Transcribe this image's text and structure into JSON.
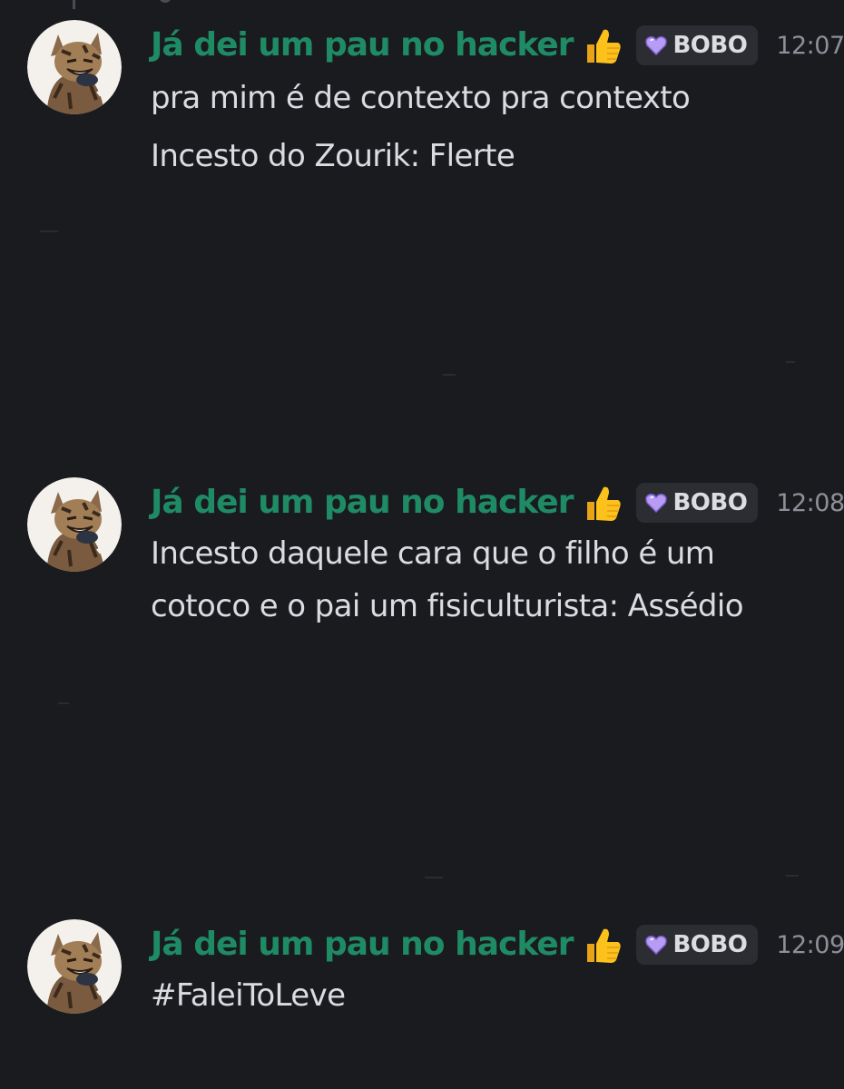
{
  "messages": [
    {
      "username": "Já dei um pau no hacker",
      "badge_emoji": "👍",
      "role": "BOBO",
      "time": "12:07",
      "lines": [
        "pra mim é de contexto pra contexto",
        "Incesto do Zourik: Flerte"
      ]
    },
    {
      "username": "Já dei um pau no hacker",
      "badge_emoji": "👍",
      "role": "BOBO",
      "time": "12:08",
      "lines": [
        "Incesto daquele cara que o filho é um",
        "cotoco e o pai um fisiculturista: Assédio"
      ]
    },
    {
      "username": "Já dei um pau no hacker",
      "badge_emoji": "👍",
      "role": "BOBO",
      "time": "12:09",
      "lines": [
        "#FaleiToLeve"
      ]
    }
  ],
  "colors": {
    "background": "#1a1b1f",
    "username": "#1f8b65",
    "text": "#dbdce1",
    "timestamp": "#8d9099",
    "badge_bg": "#2b2d33",
    "heart": "#b89cf4"
  },
  "icons": {
    "avatar": "tabby-cat-avatar",
    "emoji": "thumbs-up-icon",
    "role": "purple-heart-icon"
  }
}
